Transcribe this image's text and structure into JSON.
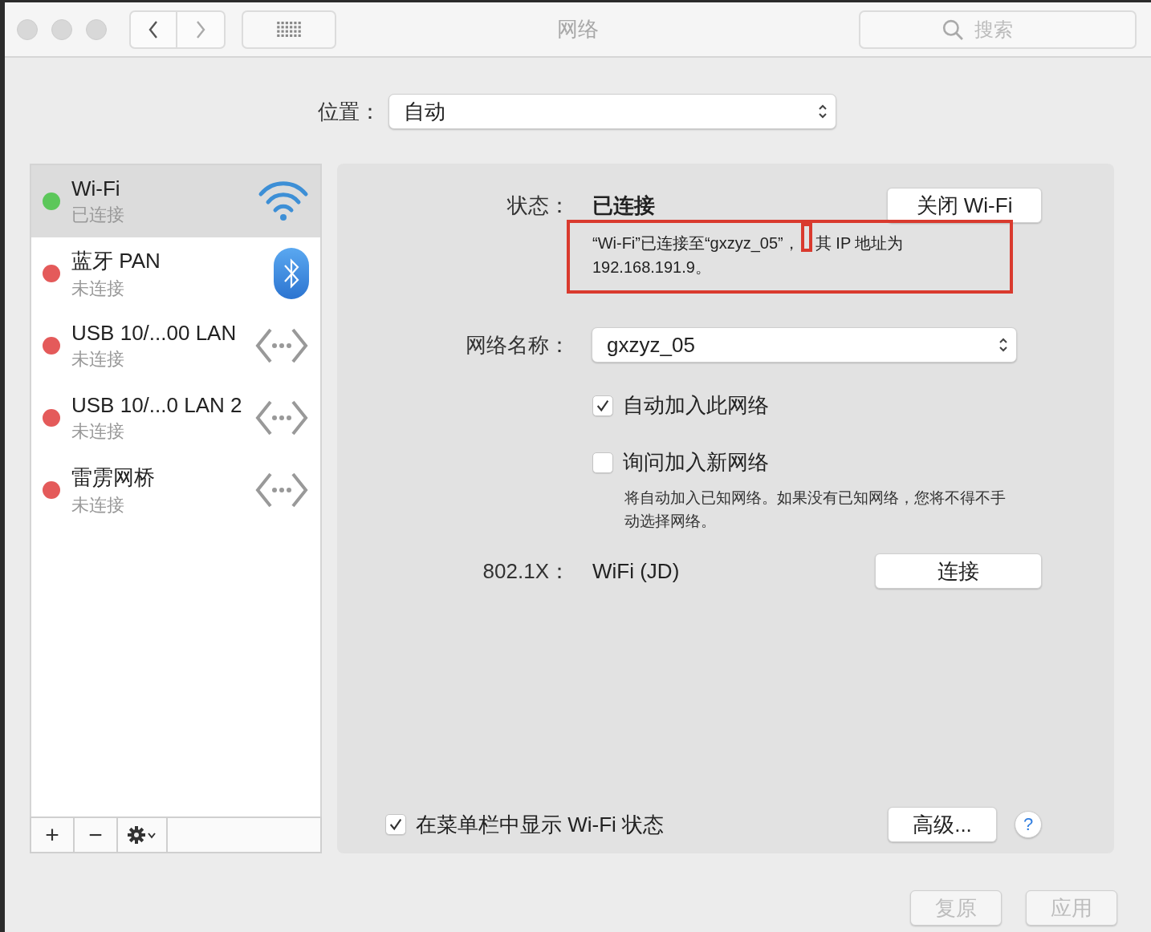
{
  "window": {
    "title": "网络",
    "search": {
      "placeholder": "搜索"
    }
  },
  "location": {
    "label": "位置：",
    "value": "自动"
  },
  "services": [
    {
      "name": "Wi-Fi",
      "status": "已连接",
      "color": "#5cc75a",
      "selected": true,
      "kind": "wifi"
    },
    {
      "name": "蓝牙 PAN",
      "status": "未连接",
      "color": "#e45a5a",
      "selected": false,
      "kind": "bluetooth"
    },
    {
      "name": "USB 10/...00 LAN",
      "status": "未连接",
      "color": "#e45a5a",
      "selected": false,
      "kind": "ethernet"
    },
    {
      "name": "USB 10/...0 LAN 2",
      "status": "未连接",
      "color": "#e45a5a",
      "selected": false,
      "kind": "ethernet"
    },
    {
      "name": "雷雳网桥",
      "status": "未连接",
      "color": "#e45a5a",
      "selected": false,
      "kind": "ethernet"
    }
  ],
  "sidebar_toolbar": [
    "+",
    "−"
  ],
  "detail": {
    "status": {
      "label": "状态：",
      "value": "已连接",
      "button": "关闭 Wi-Fi",
      "description": [
        "“Wi-Fi”已连接至“gxzyz_05”，",
        "其 IP 地址为",
        "192.168.191.9。"
      ],
      "annotation_frame": true,
      "annotation_marker": true
    },
    "network_name": {
      "label": "网络名称：",
      "value": "gxzyz_05"
    },
    "options": [
      {
        "label": "自动加入此网络",
        "checked": true
      },
      {
        "label": "询问加入新网络",
        "checked": false
      }
    ],
    "note": "将自动加入已知网络。如果没有已知网络，您将不得不手动选择网络。",
    "dot1x": {
      "label": "802.1X：",
      "value": "WiFi (JD)",
      "button": "连接"
    },
    "menu_bar_option": {
      "label": "在菜单栏中显示 Wi-Fi 状态",
      "checked": true
    },
    "advanced_button": "高级...",
    "help": "?"
  },
  "footer_buttons": [
    {
      "label": "复原",
      "disabled": true
    },
    {
      "label": "应用",
      "disabled": true
    }
  ]
}
